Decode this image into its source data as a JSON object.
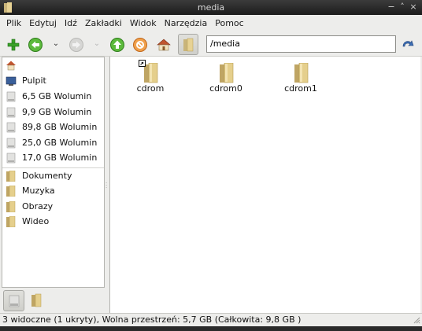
{
  "window": {
    "title": "media"
  },
  "window_controls": {
    "menu": "−",
    "minimize": "˄",
    "close": "×"
  },
  "menubar": {
    "items": [
      "Plik",
      "Edytuj",
      "Idź",
      "Zakładki",
      "Widok",
      "Narzędzia",
      "Pomoc"
    ]
  },
  "toolbar": {
    "back_dropdown": "⌄",
    "forward_dropdown": "⌄",
    "icons": [
      "new-folder-icon",
      "back-icon",
      "forward-icon",
      "up-icon",
      "stop-icon",
      "home-icon",
      "folder-toggle-icon",
      "go-icon"
    ]
  },
  "location": {
    "value": "/media"
  },
  "sidebar": {
    "places": [
      {
        "label": "",
        "icon": "home-icon"
      },
      {
        "label": "Pulpit",
        "icon": "desktop-icon"
      },
      {
        "label": "6,5 GB Wolumin",
        "icon": "drive-icon"
      },
      {
        "label": "9,9 GB Wolumin",
        "icon": "drive-icon"
      },
      {
        "label": "89,8 GB Wolumin",
        "icon": "drive-icon"
      },
      {
        "label": "25,0 GB Wolumin",
        "icon": "drive-icon"
      },
      {
        "label": "17,0 GB Wolumin",
        "icon": "drive-icon"
      }
    ],
    "bookmarks": [
      {
        "label": "Dokumenty",
        "icon": "folder-icon"
      },
      {
        "label": "Muzyka",
        "icon": "folder-icon"
      },
      {
        "label": "Obrazy",
        "icon": "folder-icon"
      },
      {
        "label": "Wideo",
        "icon": "folder-icon"
      }
    ]
  },
  "files": [
    {
      "name": "cdrom",
      "icon": "folder-icon",
      "symlink": true
    },
    {
      "name": "cdrom0",
      "icon": "folder-icon",
      "symlink": false
    },
    {
      "name": "cdrom1",
      "icon": "folder-icon",
      "symlink": false
    }
  ],
  "status": {
    "text": "3 widoczne (1 ukryty), Wolna przestrzeń: 5,7 GB (Całkowita: 9,8 GB )"
  },
  "colors": {
    "titlebar": "#2b2b2b",
    "window_bg": "#ededeb",
    "folder": "#d9b860",
    "accent_green": "#3aa229"
  }
}
